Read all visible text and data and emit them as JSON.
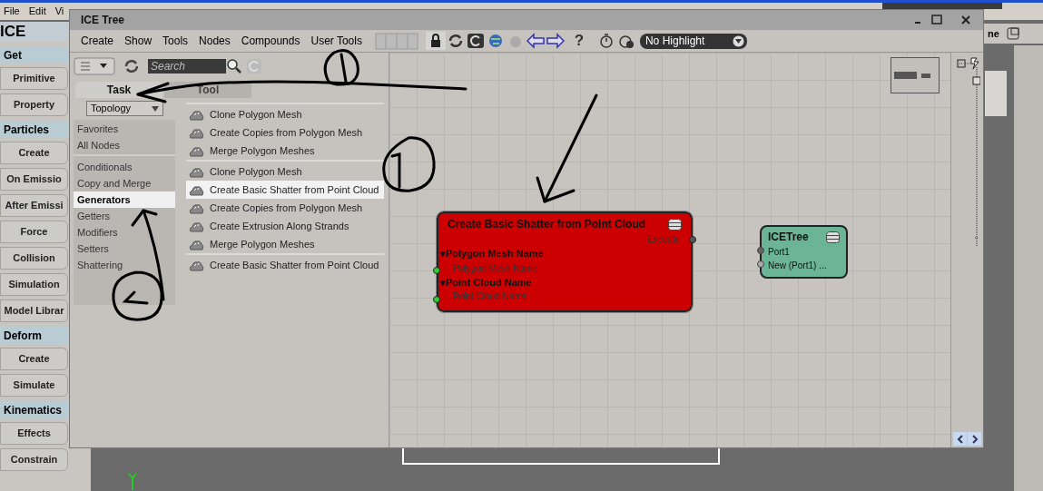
{
  "app_menu": [
    "File",
    "Edit",
    "Vi"
  ],
  "right_header": {
    "label": "ne"
  },
  "left_toolbar": {
    "title": "ICE",
    "sections": [
      {
        "label": "Get",
        "buttons": [
          "Primitive",
          "Property"
        ]
      },
      {
        "label": "Particles",
        "buttons": [
          "Create",
          "On Emissio",
          "After Emissi",
          "Force",
          "Collision",
          "Simulation",
          "Model Librar"
        ]
      },
      {
        "label": "Deform",
        "buttons": [
          "Create",
          "Simulate"
        ]
      },
      {
        "label": "Kinematics",
        "buttons": [
          "Effects",
          "Constrain"
        ]
      }
    ]
  },
  "ice_tree": {
    "title": "ICE Tree",
    "menu": [
      "Create",
      "Show",
      "Tools",
      "Nodes",
      "Compounds",
      "User Tools"
    ],
    "help_label": "?",
    "highlight": "No Highlight",
    "search": {
      "placeholder": "Search"
    },
    "tabs": [
      {
        "label": "Task",
        "selected": true
      },
      {
        "label": "Tool",
        "selected": false
      }
    ],
    "filter": "Topology",
    "category_groups": [
      {
        "items": [
          {
            "label": "Favorites",
            "selected": false
          },
          {
            "label": "All Nodes",
            "selected": false
          }
        ]
      },
      {
        "items": [
          {
            "label": "Conditionals",
            "selected": false
          },
          {
            "label": "Copy and Merge",
            "selected": false
          },
          {
            "label": "Generators",
            "selected": true
          },
          {
            "label": "Getters",
            "selected": false
          },
          {
            "label": "Modifiers",
            "selected": false
          },
          {
            "label": "Setters",
            "selected": false
          },
          {
            "label": "Shattering",
            "selected": false
          }
        ]
      }
    ],
    "node_groups": [
      {
        "items": [
          {
            "label": "Clone Polygon Mesh",
            "selected": false
          },
          {
            "label": "Create Copies from Polygon Mesh",
            "selected": false
          },
          {
            "label": "Merge Polygon Meshes",
            "selected": false
          }
        ]
      },
      {
        "items": [
          {
            "label": "Clone Polygon Mesh",
            "selected": false
          },
          {
            "label": "Create Basic Shatter from Point Cloud",
            "selected": true
          },
          {
            "label": "Create Copies from Polygon Mesh",
            "selected": false
          },
          {
            "label": "Create Extrusion Along Strands",
            "selected": false
          },
          {
            "label": "Merge Polygon Meshes",
            "selected": false
          }
        ]
      },
      {
        "items": [
          {
            "label": "Create Basic Shatter from Point Cloud",
            "selected": false
          }
        ]
      }
    ],
    "graph_nodes": [
      {
        "kind": "compound",
        "title": "Create Basic Shatter from Point Cloud",
        "color": "#cc0000",
        "output": "Execute",
        "groups": [
          {
            "label": "▾Polygon Mesh Name",
            "port": "Polygon Mesh Name"
          },
          {
            "label": "▾Point Cloud Name",
            "port": "Point Cloud Name"
          }
        ]
      },
      {
        "kind": "root",
        "title": "ICETree",
        "color": "#6cb496",
        "ports": [
          "Port1",
          "New (Port1) ..."
        ]
      }
    ]
  }
}
